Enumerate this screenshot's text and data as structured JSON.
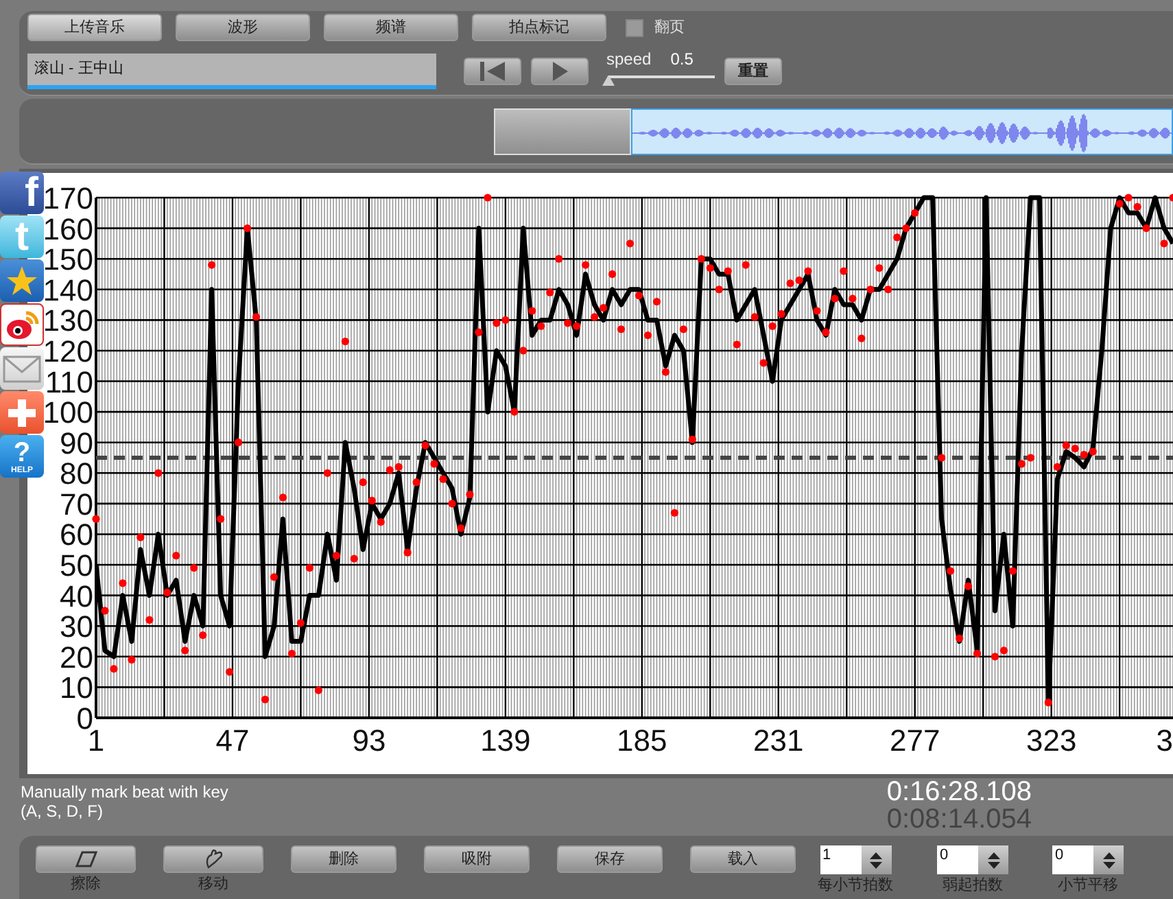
{
  "toolbar": {
    "tabs": [
      {
        "label": "上传音乐",
        "selected": true
      },
      {
        "label": "波形",
        "selected": false
      },
      {
        "label": "频谱",
        "selected": false
      },
      {
        "label": "拍点标记",
        "selected": false
      }
    ],
    "page_turn": {
      "label": "翻页",
      "checked": false
    }
  },
  "song_field": {
    "value": "滚山 - 王中山"
  },
  "speed": {
    "label": "speed",
    "reading": "0.5",
    "level": 0
  },
  "reset_button": "重置",
  "share_icons": [
    {
      "kind": "facebook",
      "glyph": "f"
    },
    {
      "kind": "twitter",
      "glyph": "t"
    },
    {
      "kind": "qzone"
    },
    {
      "kind": "weibo"
    },
    {
      "kind": "mail"
    },
    {
      "kind": "plus"
    },
    {
      "kind": "help",
      "glyph": "?",
      "caption": "HELP"
    }
  ],
  "chart": {
    "cut_tick_label": "3",
    "chart_data": {
      "type": "line",
      "xlim": [
        1,
        364
      ],
      "ylim": [
        0,
        170
      ],
      "grid": true,
      "xticks": [
        1,
        47,
        93,
        139,
        185,
        231,
        277,
        323
      ],
      "yticks": [
        0,
        10,
        20,
        30,
        40,
        50,
        60,
        70,
        80,
        90,
        100,
        110,
        120,
        130,
        140,
        150,
        160,
        170
      ],
      "x": [
        1,
        4,
        7,
        10,
        13,
        16,
        19,
        22,
        25,
        28,
        31,
        34,
        37,
        40,
        43,
        46,
        49,
        52,
        55,
        58,
        61,
        64,
        67,
        70,
        73,
        76,
        79,
        82,
        85,
        88,
        91,
        94,
        97,
        100,
        103,
        106,
        109,
        112,
        115,
        118,
        121,
        124,
        127,
        130,
        133,
        136,
        139,
        142,
        145,
        148,
        151,
        154,
        157,
        160,
        163,
        166,
        169,
        172,
        175,
        178,
        181,
        184,
        187,
        190,
        193,
        196,
        199,
        202,
        205,
        208,
        211,
        214,
        217,
        220,
        223,
        226,
        229,
        232,
        235,
        238,
        241,
        244,
        247,
        250,
        253,
        256,
        259,
        262,
        265,
        268,
        271,
        274,
        277,
        280,
        283,
        286,
        289,
        292,
        295,
        298,
        301,
        304,
        307,
        310,
        313,
        316,
        319,
        322,
        325,
        328,
        331,
        334,
        337,
        340,
        343,
        346,
        349,
        352,
        355,
        358,
        361,
        364
      ],
      "series": [
        {
          "type": "line",
          "color": "#000000",
          "values": [
            50,
            22,
            20,
            40,
            25,
            55,
            40,
            60,
            40,
            45,
            25,
            40,
            30,
            140,
            40,
            30,
            110,
            160,
            130,
            20,
            30,
            65,
            25,
            25,
            40,
            40,
            60,
            45,
            90,
            75,
            55,
            70,
            65,
            70,
            80,
            55,
            75,
            90,
            85,
            80,
            75,
            60,
            72,
            160,
            100,
            120,
            115,
            100,
            160,
            125,
            130,
            130,
            140,
            135,
            125,
            145,
            135,
            130,
            140,
            135,
            140,
            140,
            130,
            130,
            115,
            125,
            120,
            90,
            150,
            150,
            145,
            145,
            130,
            135,
            140,
            125,
            110,
            130,
            135,
            140,
            145,
            130,
            125,
            140,
            135,
            135,
            130,
            140,
            140,
            145,
            150,
            160,
            165,
            170,
            170,
            65,
            42,
            25,
            45,
            22,
            170,
            35,
            60,
            30,
            120,
            170,
            170,
            5,
            78,
            87,
            85,
            82,
            88,
            120,
            160,
            170,
            165,
            165,
            160,
            170,
            160,
            155
          ]
        },
        {
          "type": "scatter",
          "color": "#ff0000",
          "values": [
            65,
            35,
            16,
            44,
            19,
            59,
            32,
            80,
            41,
            53,
            22,
            49,
            27,
            148,
            65,
            15,
            90,
            160,
            131,
            6,
            46,
            72,
            21,
            31,
            49,
            9,
            80,
            53,
            123,
            52,
            77,
            71,
            64,
            81,
            82,
            54,
            77,
            89,
            83,
            78,
            70,
            62,
            73,
            126,
            170,
            129,
            130,
            100,
            120,
            133,
            128,
            139,
            150,
            129,
            128,
            148,
            131,
            134,
            145,
            127,
            155,
            138,
            125,
            136,
            113,
            67,
            127,
            91,
            150,
            147,
            140,
            146,
            122,
            148,
            131,
            116,
            128,
            132,
            142,
            143,
            146,
            133,
            126,
            137,
            146,
            137,
            124,
            140,
            147,
            140,
            157,
            160,
            165,
            null,
            null,
            85,
            48,
            26,
            43,
            21,
            null,
            20,
            22,
            48,
            83,
            85,
            null,
            5,
            82,
            89,
            88,
            86,
            87,
            null,
            null,
            168,
            170,
            167,
            160,
            null,
            155,
            170
          ]
        }
      ],
      "ref_lines": [
        {
          "axis": "y",
          "value": 85
        }
      ]
    }
  },
  "hint": {
    "lines": [
      "Manually mark beat with key",
      "(A, S, D, F)"
    ]
  },
  "times": {
    "total": "0:16:28.108",
    "current": "0:08:14.054"
  },
  "tools": [
    {
      "kind": "eraser",
      "label": "擦除"
    },
    {
      "kind": "hand",
      "label": "移动"
    },
    {
      "kind": "text",
      "label": "删除"
    },
    {
      "kind": "text",
      "label": "吸附"
    },
    {
      "kind": "text",
      "label": "保存"
    },
    {
      "kind": "text",
      "label": "载入"
    }
  ],
  "spinners": [
    {
      "value": "1",
      "label": "每小节拍数"
    },
    {
      "value": "0",
      "label": "弱起拍数"
    },
    {
      "value": "0",
      "label": "小节平移"
    }
  ]
}
